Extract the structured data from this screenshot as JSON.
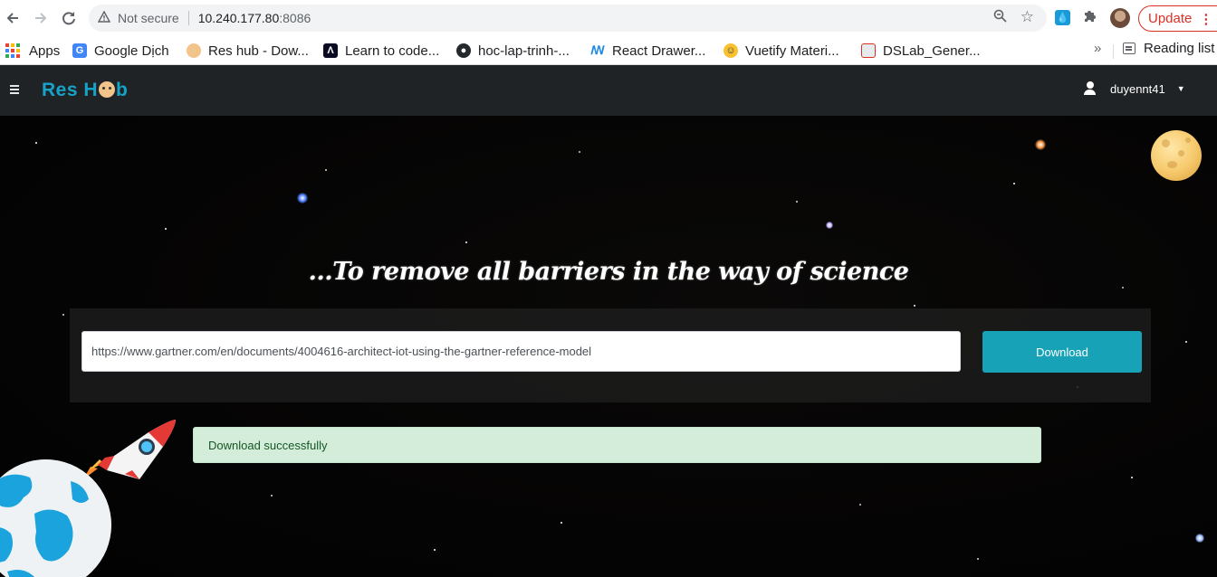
{
  "browser": {
    "security_label": "Not secure",
    "url_host": "10.240.177.80",
    "url_port": ":8086",
    "update_label": "Update",
    "bookmarks": [
      {
        "label": "Apps",
        "icon": "apps-grid-icon"
      },
      {
        "label": "Google Dịch",
        "icon": "google-translate-icon"
      },
      {
        "label": "Res hub - Dow...",
        "icon": "reshub-icon"
      },
      {
        "label": "Learn to code...",
        "icon": "freecodecamp-icon"
      },
      {
        "label": "hoc-lap-trinh-...",
        "icon": "github-icon"
      },
      {
        "label": "React Drawer...",
        "icon": "react-drawer-icon"
      },
      {
        "label": "Vuetify Materi...",
        "icon": "emoji-icon"
      },
      {
        "label": "DSLab_Gener...",
        "icon": "dslab-icon"
      }
    ],
    "more_label": "»",
    "reading_list_label": "Reading list"
  },
  "app": {
    "brand_left": "Res H",
    "brand_right": "b",
    "username": "duyennt41"
  },
  "hero": {
    "tagline": "...To remove all barriers in the way of science",
    "url_value": "https://www.gartner.com/en/documents/4004616-architect-iot-using-the-gartner-reference-model",
    "download_label": "Download",
    "alert_text": "Download successfully"
  },
  "colors": {
    "accent": "#17a2b8",
    "brand": "#17a2c8",
    "navbar": "#1f2326",
    "alert_bg": "#d4edda",
    "alert_text": "#155724",
    "update": "#d93025"
  }
}
